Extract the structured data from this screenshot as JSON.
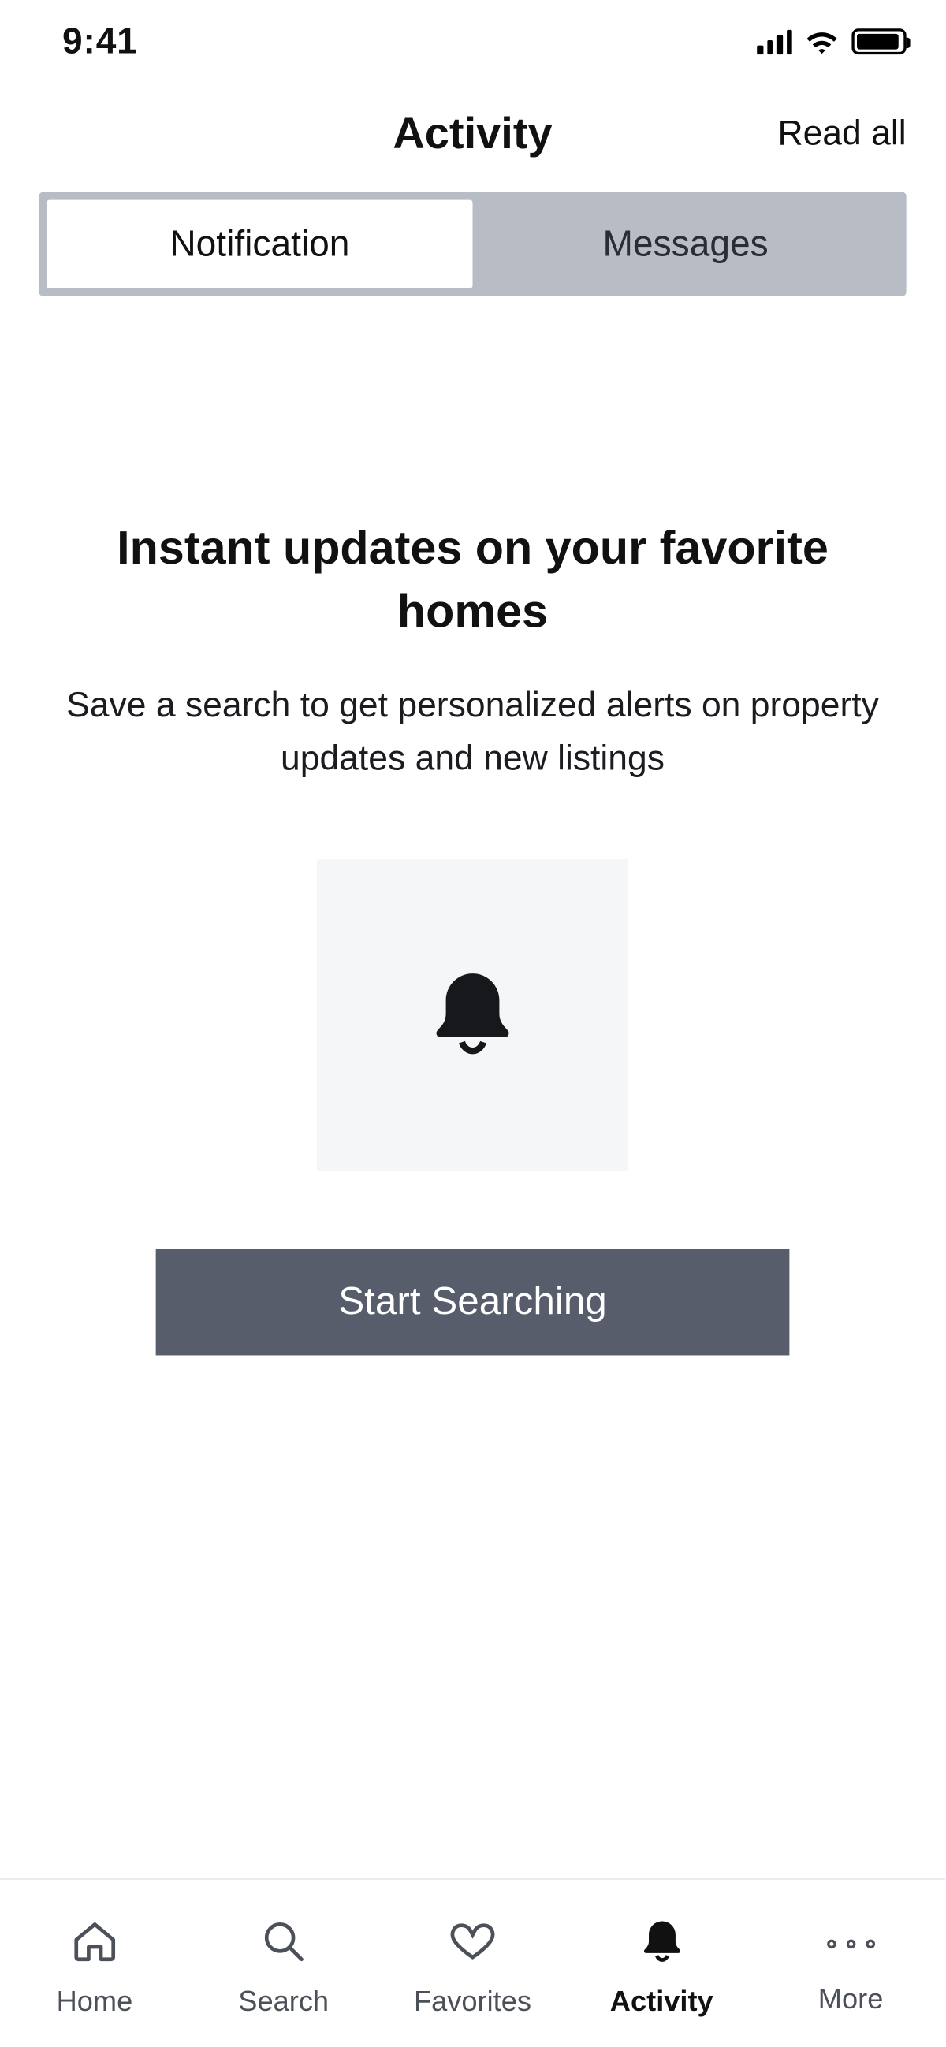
{
  "status": {
    "time": "9:41"
  },
  "header": {
    "title": "Activity",
    "action": "Read all"
  },
  "tabs": {
    "items": [
      {
        "label": "Notification"
      },
      {
        "label": "Messages"
      }
    ]
  },
  "empty": {
    "title": "Instant updates on your favorite homes",
    "subtitle": "Save a search to get personalized alerts on property updates and new listings",
    "cta": "Start Searching"
  },
  "tabbar": {
    "items": [
      {
        "label": "Home"
      },
      {
        "label": "Search"
      },
      {
        "label": "Favorites"
      },
      {
        "label": "Activity"
      },
      {
        "label": "More"
      }
    ]
  }
}
